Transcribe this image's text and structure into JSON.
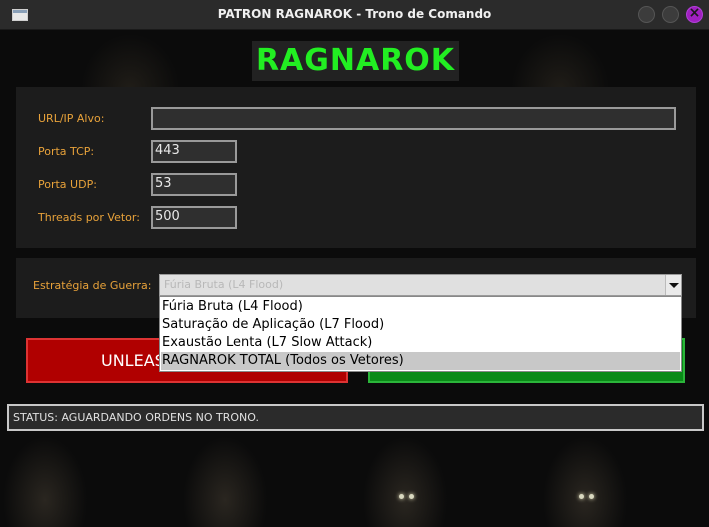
{
  "window": {
    "title": "PATRON RAGNAROK - Trono de Comando",
    "close_glyph": "×"
  },
  "header": {
    "logo_text": "RAGNAROK"
  },
  "target": {
    "url_label": "URL/IP Alvo:",
    "url_value": "",
    "tcp_label": "Porta TCP:",
    "tcp_value": "443",
    "udp_label": "Porta UDP:",
    "udp_value": "53",
    "threads_label": "Threads por Vetor:",
    "threads_value": "500"
  },
  "strategy": {
    "label": "Estratégia de Guerra:",
    "selected": "Fúria Bruta (L4 Flood)",
    "options": [
      "Fúria Bruta (L4 Flood)",
      "Saturação de Aplicação (L7 Flood)",
      "Exaustão Lenta (L7 Slow Attack)",
      "RAGNAROK TOTAL (Todos os Vetores)"
    ],
    "highlighted_index": 3
  },
  "actions": {
    "unleash_label": "UNLEASH"
  },
  "status": {
    "text": "STATUS: AGUARDANDO ORDENS NO TRONO."
  },
  "colors": {
    "logo": "#22ee22",
    "label": "#e8a23a",
    "unleash": "#b00000",
    "go": "#0a8a18"
  }
}
